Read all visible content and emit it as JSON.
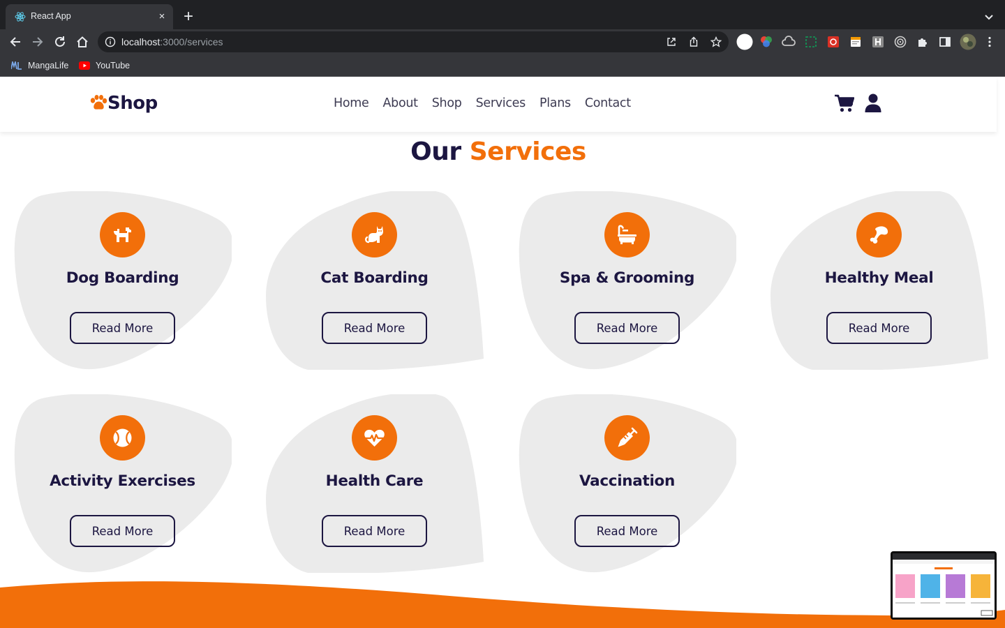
{
  "browser": {
    "tab_title": "React App",
    "tab_close": "×",
    "new_tab": "+",
    "url_host": "localhost",
    "url_path": ":3000/services",
    "bookmarks": [
      {
        "label": "MangaLife",
        "icon": "mangalife-icon"
      },
      {
        "label": "YouTube",
        "icon": "youtube-icon"
      }
    ]
  },
  "header": {
    "logo_text": "Shop",
    "nav": [
      "Home",
      "About",
      "Shop",
      "Services",
      "Plans",
      "Contact"
    ]
  },
  "page": {
    "title_prefix": "Our",
    "title_accent": "Services"
  },
  "services": [
    {
      "title": "Dog Boarding",
      "icon": "dog-icon",
      "button": "Read More"
    },
    {
      "title": "Cat Boarding",
      "icon": "cat-icon",
      "button": "Read More"
    },
    {
      "title": "Spa & Grooming",
      "icon": "bath-icon",
      "button": "Read More"
    },
    {
      "title": "Healthy Meal",
      "icon": "bone-icon",
      "button": "Read More"
    },
    {
      "title": "Activity Exercises",
      "icon": "ball-icon",
      "button": "Read More"
    },
    {
      "title": "Health Care",
      "icon": "heartbeat-icon",
      "button": "Read More"
    },
    {
      "title": "Vaccination",
      "icon": "syringe-icon",
      "button": "Read More"
    }
  ],
  "colors": {
    "accent": "#f26f0a",
    "navy": "#1c1641",
    "card": "#ebebeb"
  }
}
